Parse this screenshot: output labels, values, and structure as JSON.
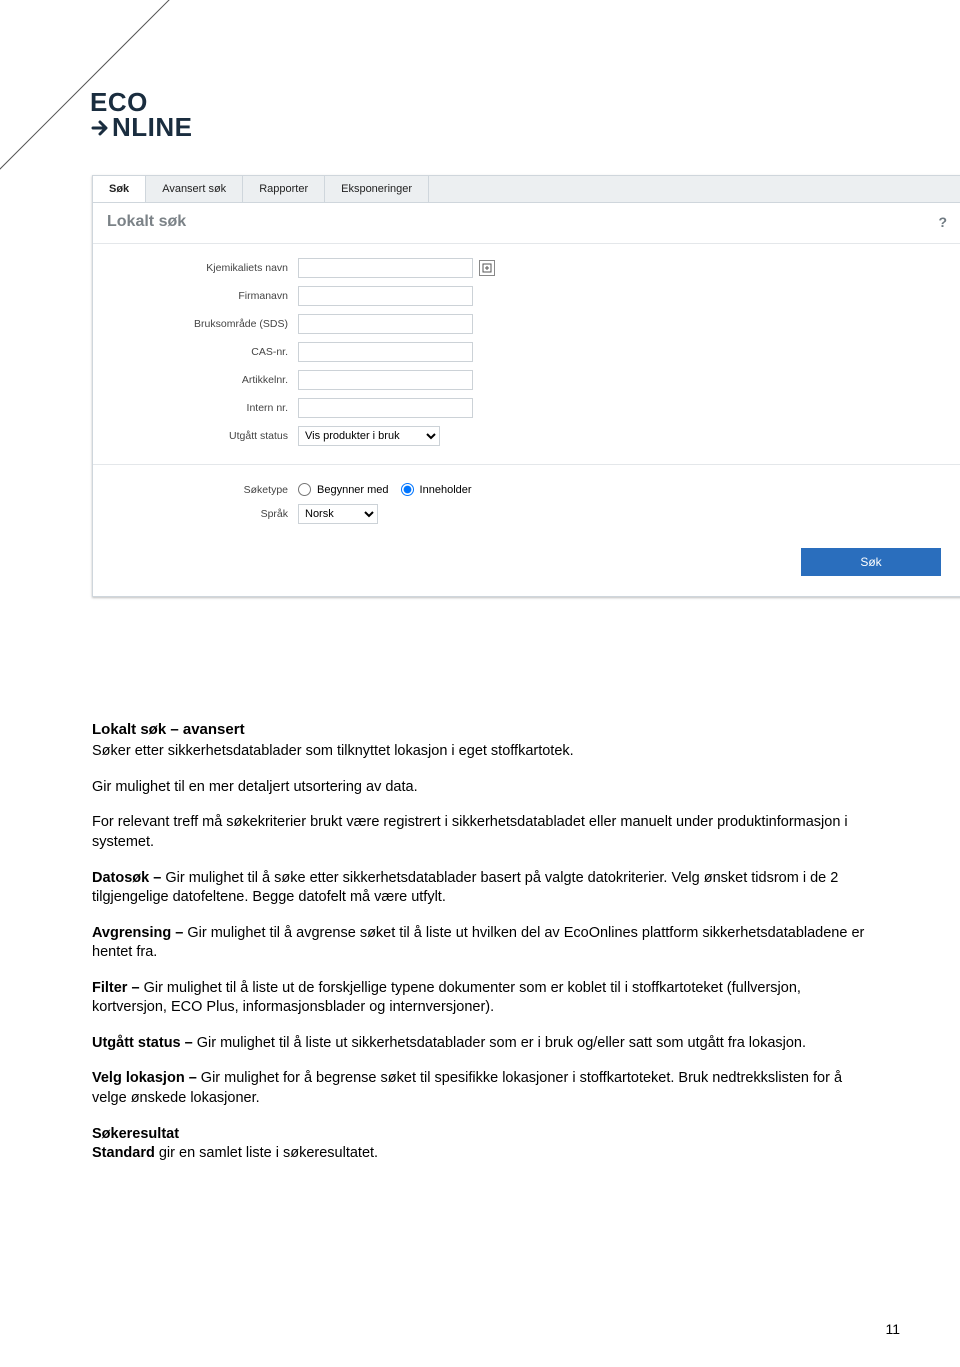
{
  "logo_line1": "ECO",
  "logo_line2": "NLINE",
  "tabs": [
    {
      "label": "Søk"
    },
    {
      "label": "Avansert søk"
    },
    {
      "label": "Rapporter"
    },
    {
      "label": "Eksponeringer"
    }
  ],
  "panel_title": "Lokalt søk",
  "form": {
    "kjemikaliets_navn": {
      "label": "Kjemikaliets navn",
      "value": ""
    },
    "firmanavn": {
      "label": "Firmanavn",
      "value": ""
    },
    "bruksomrade": {
      "label": "Bruksområde (SDS)",
      "value": ""
    },
    "cas_nr": {
      "label": "CAS-nr.",
      "value": ""
    },
    "artikkelnr": {
      "label": "Artikkelnr.",
      "value": ""
    },
    "intern_nr": {
      "label": "Intern nr.",
      "value": ""
    },
    "utgatt_status": {
      "label": "Utgått status",
      "selected": "Vis produkter i bruk"
    },
    "soketype": {
      "label": "Søketype",
      "option_begynner": "Begynner med",
      "option_inneholder": "Inneholder"
    },
    "sprak": {
      "label": "Språk",
      "selected": "Norsk"
    },
    "submit": "Søk"
  },
  "doc": {
    "heading": "Lokalt søk – avansert",
    "p1": "Søker etter sikkerhetsdatablader som tilknyttet lokasjon i eget stoffkartotek.",
    "p2": "Gir mulighet til en mer detaljert utsortering av data.",
    "p3": "For relevant treff må søkekriterier brukt være registrert i sikkerhetsdatabladet eller manuelt under produktinformasjon i systemet.",
    "p4_b": "Datosøk – ",
    "p4": "Gir mulighet til å søke etter sikkerhetsdatablader basert på valgte datokriterier. Velg ønsket tidsrom i de 2 tilgjengelige datofeltene. Begge datofelt må være utfylt.",
    "p5_b": "Avgrensing – ",
    "p5": "Gir mulighet til å avgrense søket til å liste ut hvilken del av EcoOnlines plattform sikkerhetsdatabladene er hentet fra.",
    "p6_b": "Filter – ",
    "p6": "Gir mulighet til å liste ut de forskjellige typene dokumenter som er koblet til i stoffkartoteket (fullversjon, kortversjon, ECO Plus, informasjonsblader og internversjoner).",
    "p7_b": "Utgått status – ",
    "p7": "Gir mulighet til å liste ut sikkerhetsdatablader som er i bruk og/eller satt som utgått fra lokasjon.",
    "p8_b": "Velg lokasjon – ",
    "p8": "Gir mulighet for å begrense søket til spesifikke lokasjoner i stoffkartoteket. Bruk nedtrekkslisten for å velge ønskede lokasjoner.",
    "p9_b": "Søkeresultat",
    "p9_2b": "Standard",
    "p9": " gir en samlet liste i søkeresultatet."
  },
  "page_number": "11"
}
